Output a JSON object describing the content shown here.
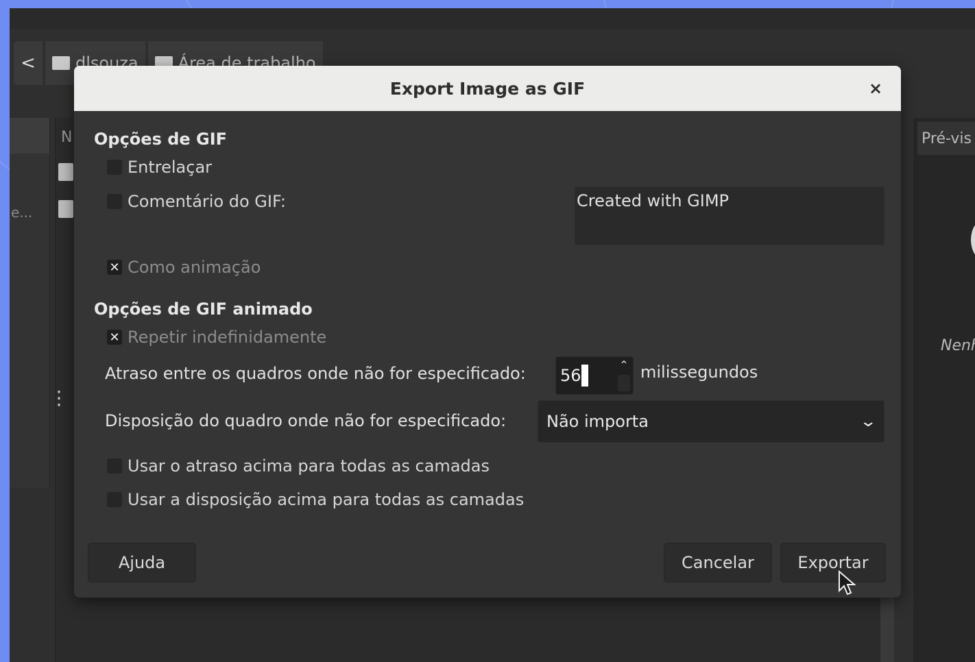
{
  "pathbar": {
    "back_glyph": "<",
    "crumbs": [
      {
        "label": "dlsouza",
        "icon": "folder-icon"
      },
      {
        "label": "Área de trabalho",
        "icon": "folder-icon"
      }
    ]
  },
  "file_list": {
    "column_header": "N"
  },
  "left_pane": {
    "truncated_label": "e..."
  },
  "preview": {
    "header": "Pré-vis",
    "empty_text": "Nenh"
  },
  "dialog": {
    "title": "Export Image as GIF",
    "close_glyph": "×",
    "gif_options": {
      "heading": "Opções de GIF",
      "interlace": {
        "label": "Entrelaçar",
        "checked": false
      },
      "comment": {
        "label": "Comentário do GIF:",
        "checked": false,
        "value": "Created with GIMP"
      },
      "as_animation": {
        "label": "Como animação",
        "checked": true
      }
    },
    "animated_options": {
      "heading": "Opções de GIF animado",
      "loop": {
        "label": "Repetir indefinidamente",
        "checked": true
      },
      "delay": {
        "label": "Atraso entre os quadros onde não for especificado:",
        "value": "56",
        "unit": "milissegundos"
      },
      "disposal": {
        "label": "Disposição do quadro onde não for especificado:",
        "selected": "Não importa"
      },
      "use_delay_all": {
        "label": "Usar o atraso acima para todas as camadas",
        "checked": false
      },
      "use_disposal_all": {
        "label": "Usar a disposição acima para todas as camadas",
        "checked": false
      }
    },
    "buttons": {
      "help": "Ajuda",
      "cancel": "Cancelar",
      "export": "Exportar"
    }
  },
  "colors": {
    "desktop_background": "#6f8cf2",
    "dialog_body": "#353535",
    "dialog_titlebar": "#ececea"
  }
}
